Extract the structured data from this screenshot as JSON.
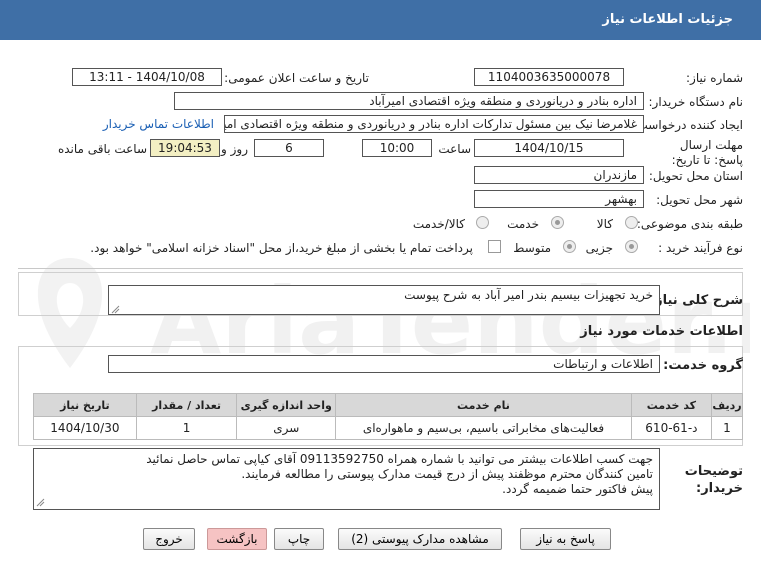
{
  "header": {
    "title": "جزئیات اطلاعات نیاز"
  },
  "form": {
    "need_number_label": "شماره نیاز:",
    "need_number": "1104003635000078",
    "announce_label": "تاریخ و ساعت اعلان عمومی:",
    "announce_value": "1404/10/08 - 13:11",
    "buyer_label": "نام دستگاه خریدار:",
    "buyer_value": "اداره بنادر و دریانوردی و منطقه ویژه اقتصادی امیرآباد",
    "requester_label": "ایجاد کننده درخواست:",
    "requester_value": "غلامرضا نیک بین مسئول تدارکات اداره بنادر و دریانوردی و منطقه ویژه اقتصادی امیرآباد",
    "contact_link": "اطلاعات تماس خریدار",
    "deadline_label": "مهلت ارسال پاسخ: تا تاریخ:",
    "deadline_date": "1404/10/15",
    "time_label": "ساعت",
    "deadline_time": "10:00",
    "days_value": "6",
    "days_label": "روز و",
    "remaining_time": "19:04:53",
    "remaining_label": "ساعت باقی مانده",
    "province_label": "استان محل تحویل:",
    "province_value": "مازندران",
    "city_label": "شهر محل تحویل:",
    "city_value": "بهشهر",
    "category_label": "طبقه بندی موضوعی:",
    "category_options": [
      "کالا",
      "خدمت",
      "کالا/خدمت"
    ],
    "process_label": "نوع فرآیند خرید :",
    "process_options": [
      "جزیی",
      "متوسط"
    ],
    "payment_note": "پرداخت تمام یا بخشی از مبلغ خرید،از محل \"اسناد خزانه اسلامی\" خواهد بود."
  },
  "summary": {
    "label": "شرح کلی نیاز:",
    "value": "خرید تجهیزات بیسیم بندر امیر آباد به شرح پیوست"
  },
  "services": {
    "section_title": "اطلاعات خدمات مورد نیاز",
    "group_label": "گروه خدمت:",
    "group_value": "اطلاعات و ارتباطات",
    "columns": [
      "ردیف",
      "کد خدمت",
      "نام خدمت",
      "واحد اندازه گیری",
      "تعداد / مقدار",
      "تاریخ نیاز"
    ],
    "rows": [
      [
        "1",
        "د-61-610",
        "فعالیت‌های مخابراتی باسیم، بی‌سیم و ماهواره‌ای",
        "سری",
        "1",
        "1404/10/30"
      ]
    ]
  },
  "notes": {
    "label": "توضیحات خریدار:",
    "lines": [
      "جهت کسب اطلاعات بیشتر می توانید با شماره همراه 09113592750 آقای کیاپی تماس حاصل نمائید",
      "تامین کنندگان محترم موظفند پیش از درج قیمت مدارک پیوستی را مطالعه فرمایند.",
      "پیش فاکتور حتما ضمیمه گردد."
    ]
  },
  "buttons": {
    "reply": "پاسخ به نیاز",
    "attachments": "مشاهده مدارک پیوستی (2)",
    "print": "چاپ",
    "back": "بازگشت",
    "exit": "خروج"
  },
  "watermark": {
    "text": "AriaTender.net"
  }
}
